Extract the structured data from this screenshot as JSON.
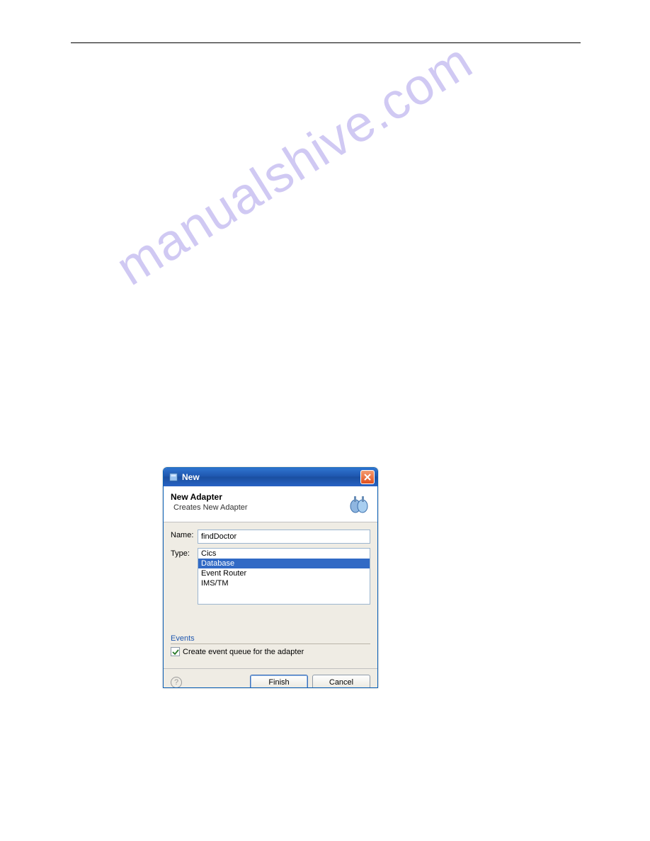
{
  "watermark": "manualshive.com",
  "dialog": {
    "title": "New",
    "header": {
      "title": "New Adapter",
      "description": "Creates New Adapter"
    },
    "form": {
      "name_label": "Name:",
      "name_value": "findDoctor",
      "type_label": "Type:",
      "type_options": [
        "Cics",
        "Database",
        "Event Router",
        "IMS/TM"
      ],
      "type_selected": "Database"
    },
    "events": {
      "section_title": "Events",
      "checkbox_label": "Create event queue for the adapter",
      "checkbox_checked": true
    },
    "buttons": {
      "finish": "Finish",
      "cancel": "Cancel"
    }
  }
}
